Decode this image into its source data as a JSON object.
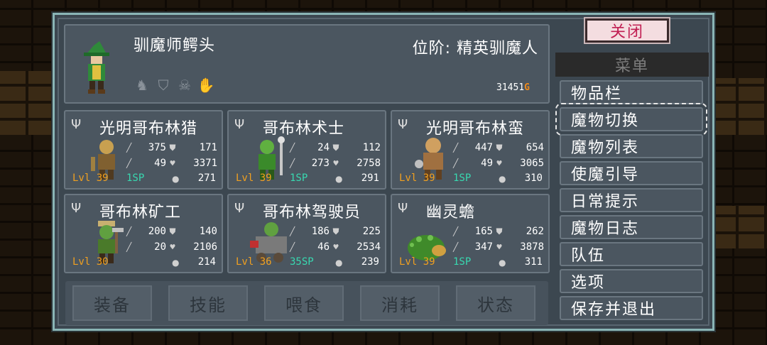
{
  "hero": {
    "name": "驯魔师鳄头",
    "rank": "位阶: 精英驯魔人",
    "gold_amount": "31451",
    "gold_unit": "G",
    "icons": [
      "claw-icon",
      "helmet-icon",
      "skull-icon",
      "glove-icon"
    ]
  },
  "monsters": [
    {
      "name": "光明哥布林猎",
      "atk": "375",
      "def": "171",
      "mag": "49",
      "hp": "3371",
      "level": "Lvl 39",
      "sp": "1SP",
      "food": "271"
    },
    {
      "name": "哥布林术士",
      "atk": "24",
      "def": "112",
      "mag": "273",
      "hp": "2758",
      "level": "Lvl 39",
      "sp": "1SP",
      "food": "291"
    },
    {
      "name": "光明哥布林蛮",
      "atk": "447",
      "def": "654",
      "mag": "49",
      "hp": "3065",
      "level": "Lvl 39",
      "sp": "1SP",
      "food": "310"
    },
    {
      "name": "哥布林矿工",
      "atk": "200",
      "def": "140",
      "mag": "20",
      "hp": "2106",
      "level": "Lvl 30",
      "sp": "",
      "food": "214"
    },
    {
      "name": "哥布林驾驶员",
      "atk": "186",
      "def": "225",
      "mag": "46",
      "hp": "2534",
      "level": "Lvl 36",
      "sp": "35SP",
      "food": "239"
    },
    {
      "name": "幽灵蟾",
      "atk": "165",
      "def": "262",
      "mag": "347",
      "hp": "3878",
      "level": "Lvl 39",
      "sp": "1SP",
      "food": "311"
    }
  ],
  "tabs": [
    "装备",
    "技能",
    "喂食",
    "消耗",
    "状态"
  ],
  "close_label": "关闭",
  "menu": {
    "title": "菜单",
    "items": [
      "物品栏",
      "魔物切换",
      "魔物列表",
      "使魔引导",
      "日常提示",
      "魔物日志",
      "队伍",
      "选项",
      "保存并退出"
    ],
    "selected_index": 1
  },
  "colors": {
    "level": "#f0a020",
    "sp": "#38d8b0",
    "gold": "#f08a1a",
    "close_text": "#c11e52"
  }
}
